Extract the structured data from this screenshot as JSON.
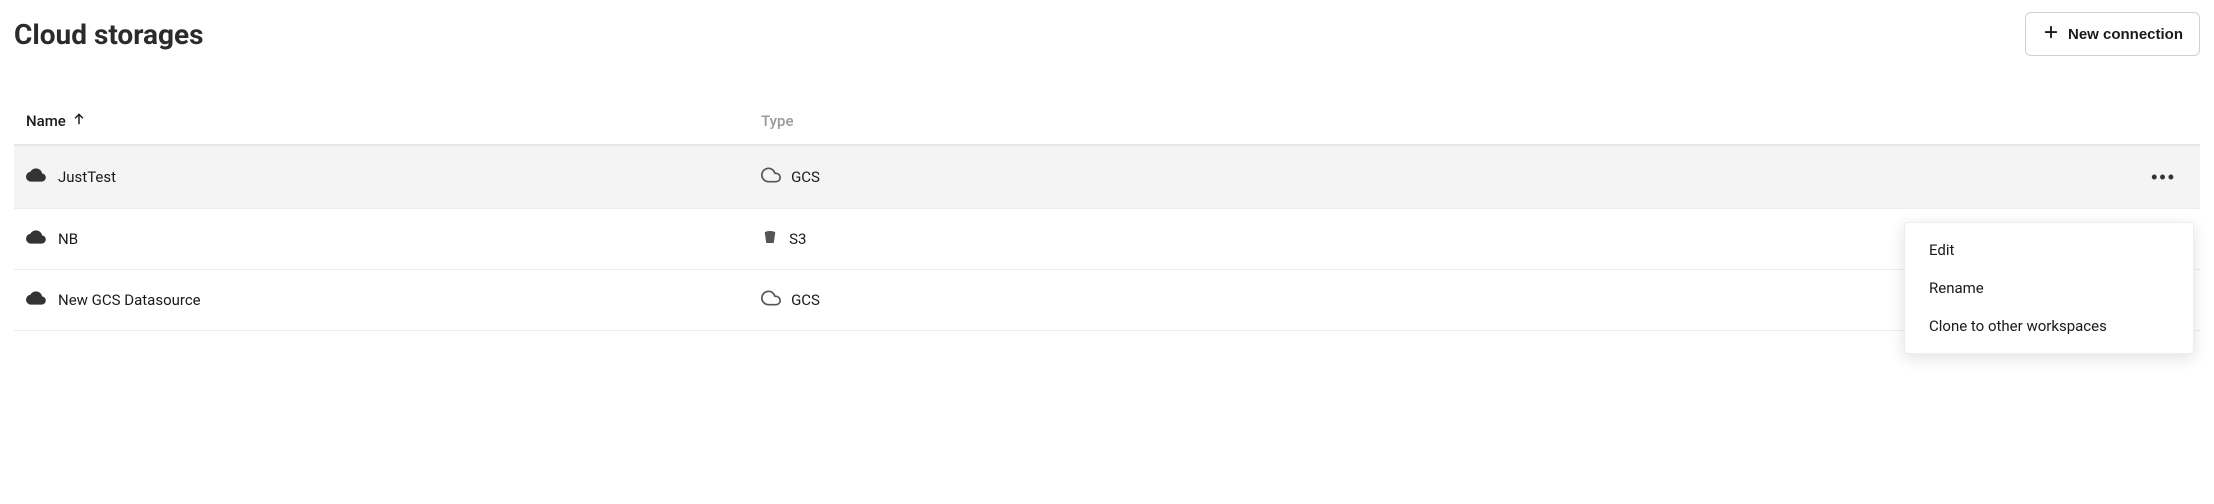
{
  "header": {
    "title": "Cloud storages",
    "new_connection_label": "New connection"
  },
  "table": {
    "columns": {
      "name": "Name",
      "type": "Type"
    },
    "sort": {
      "column": "name",
      "direction": "asc"
    },
    "rows": [
      {
        "name": "JustTest",
        "type": "GCS",
        "type_icon": "gcs",
        "selected": true
      },
      {
        "name": "NB",
        "type": "S3",
        "type_icon": "s3",
        "selected": false
      },
      {
        "name": "New GCS Datasource",
        "type": "GCS",
        "type_icon": "gcs",
        "selected": false
      }
    ]
  },
  "context_menu": {
    "visible": true,
    "items": [
      {
        "label": "Edit"
      },
      {
        "label": "Rename"
      },
      {
        "label": "Clone to other workspaces"
      }
    ]
  }
}
